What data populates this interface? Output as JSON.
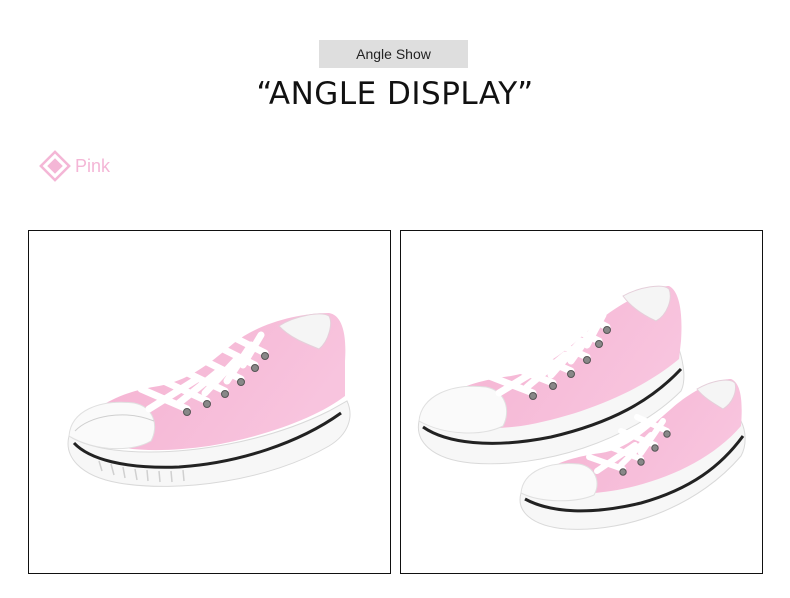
{
  "header": {
    "tag_label": "Angle Show",
    "headline": "“ANGLE DISPLAY”"
  },
  "color_option": {
    "label": "Pink",
    "icon": "diamond-icon",
    "color": "#f4b6d6"
  },
  "panels": [
    {
      "id": "single-shoe",
      "shoe_color": "#f6b9d6"
    },
    {
      "id": "pair-shoes",
      "shoe_color": "#f6b9d6"
    }
  ]
}
